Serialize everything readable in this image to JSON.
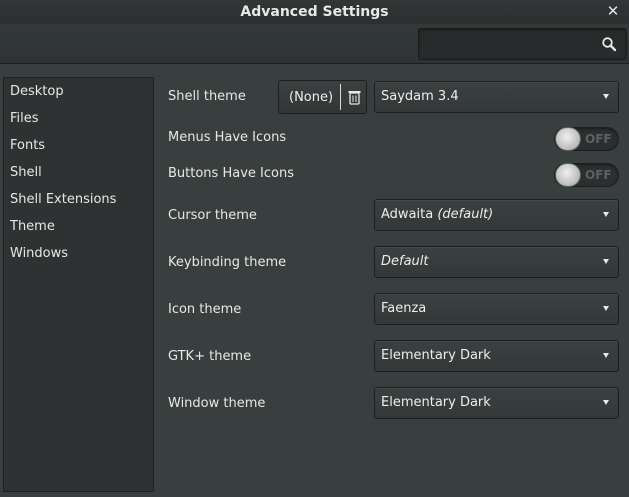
{
  "window": {
    "title": "Advanced Settings",
    "close_glyph": "✕"
  },
  "search": {
    "value": "",
    "placeholder": ""
  },
  "sidebar": {
    "items": [
      {
        "label": "Desktop"
      },
      {
        "label": "Files"
      },
      {
        "label": "Fonts"
      },
      {
        "label": "Shell"
      },
      {
        "label": "Shell Extensions"
      },
      {
        "label": "Theme"
      },
      {
        "label": "Windows"
      }
    ]
  },
  "settings": {
    "shell_theme": {
      "label": "Shell theme",
      "none_label": "(None)",
      "value": "Saydam 3.4"
    },
    "menus_have_icons": {
      "label": "Menus Have Icons",
      "state": "OFF"
    },
    "buttons_have_icons": {
      "label": "Buttons Have Icons",
      "state": "OFF"
    },
    "cursor_theme": {
      "label": "Cursor theme",
      "value": "Adwaita",
      "value_suffix": "(default)"
    },
    "keybinding_theme": {
      "label": "Keybinding theme",
      "value": "Default"
    },
    "icon_theme": {
      "label": "Icon theme",
      "value": "Faenza"
    },
    "gtk_theme": {
      "label": "GTK+ theme",
      "value": "Elementary Dark"
    },
    "window_theme": {
      "label": "Window theme",
      "value": "Elementary Dark"
    }
  },
  "colors": {
    "background": "#393f3f",
    "sidebar": "#2e3232",
    "titlebar": "#2b2f2f",
    "text": "#eeeeec",
    "switch_off_text": "#5c6262"
  }
}
